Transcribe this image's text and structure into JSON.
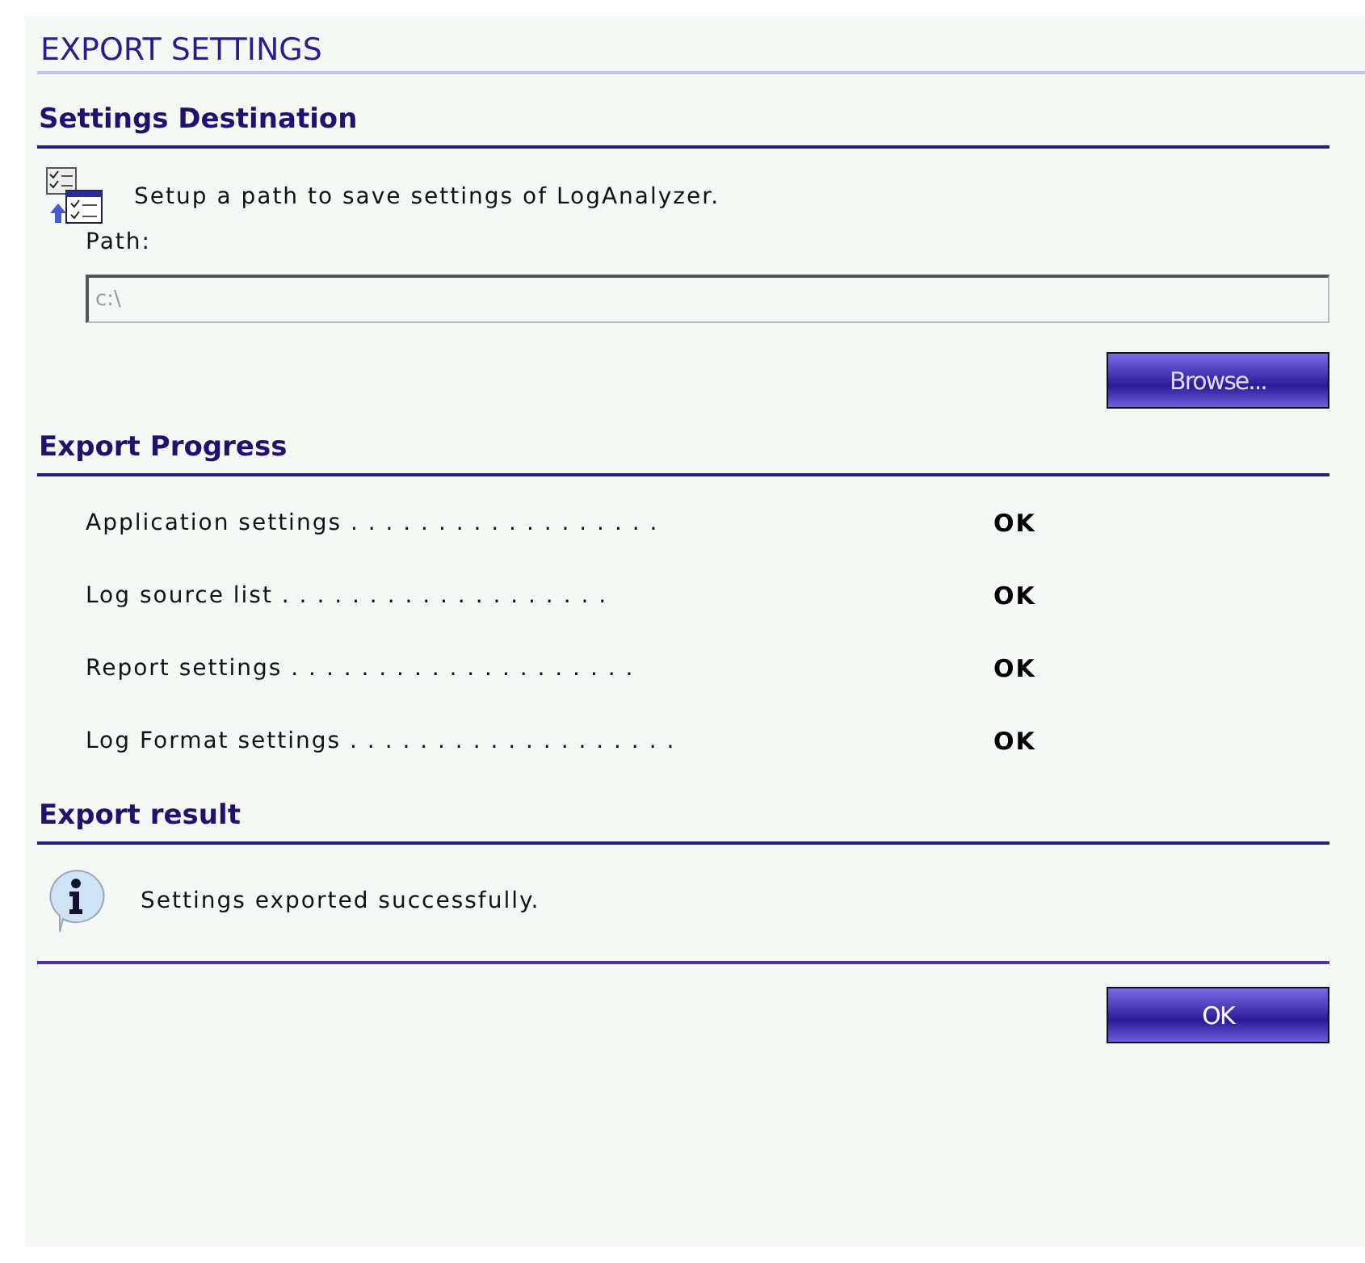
{
  "window": {
    "title": "EXPORT SETTINGS"
  },
  "destination": {
    "heading": "Settings Destination",
    "description": "Setup a path to save settings of LogAnalyzer.",
    "path": {
      "label": "Path:",
      "value": "c:\\"
    },
    "browse_button": "Browse..."
  },
  "progress": {
    "heading": "Export Progress",
    "items": [
      {
        "label": "Application settings . . . . . . . . . . . . . . . . . .",
        "status": "OK"
      },
      {
        "label": "Log source list . . . . . . . . . . . . . . . . . . .",
        "status": "OK"
      },
      {
        "label": "Report settings . . . . . . . . . . . . . . . . . . . .",
        "status": "OK"
      },
      {
        "label": "Log Format settings . . . . . . . . . . . . . . . . . . .",
        "status": "OK"
      }
    ]
  },
  "result": {
    "heading": "Export result",
    "message": "Settings exported successfully."
  },
  "buttons": [
    "OK"
  ]
}
